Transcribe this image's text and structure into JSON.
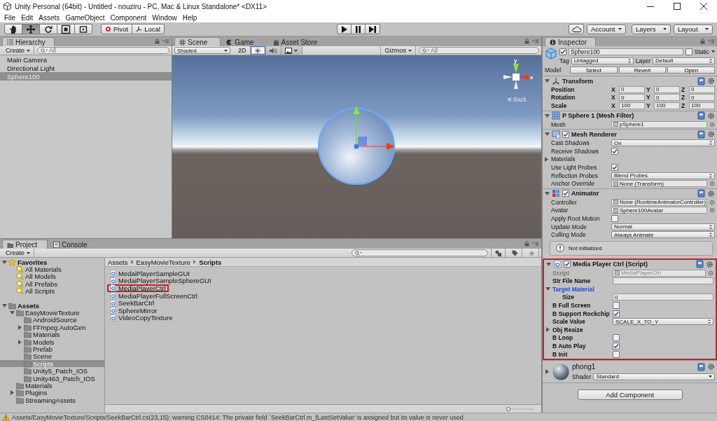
{
  "window": {
    "title": "Unity Personal (64bit) - Untitled - nouziru - PC, Mac & Linux Standalone* <DX11>"
  },
  "menu": [
    "File",
    "Edit",
    "Assets",
    "GameObject",
    "Component",
    "Window",
    "Help"
  ],
  "toolbar": {
    "tools": [
      {
        "kind": "hand",
        "selected": false
      },
      {
        "kind": "move",
        "selected": true
      },
      {
        "kind": "rotate",
        "selected": false
      },
      {
        "kind": "scale",
        "selected": false
      },
      {
        "kind": "rect",
        "selected": false
      }
    ],
    "pivot": "Pivot",
    "space": "Local",
    "account": "Account",
    "layers": "Layers",
    "layout": "Layout"
  },
  "hierarchy": {
    "tab": "Hierarchy",
    "create": "Create",
    "search_placeholder": "All",
    "items": [
      {
        "label": "Main Camera",
        "selected": false
      },
      {
        "label": "Directional Light",
        "selected": false
      },
      {
        "label": "Sphere100",
        "selected": true
      }
    ]
  },
  "scene": {
    "tabs": [
      {
        "label": "Scene",
        "selected": true
      },
      {
        "label": "Game",
        "selected": false
      },
      {
        "label": "Asset Store",
        "selected": false
      }
    ],
    "shading": "Shaded",
    "mode_2d": "2D",
    "toggles": [
      {
        "kind": "lighting",
        "on": true
      },
      {
        "kind": "audio",
        "on": false
      },
      {
        "kind": "effects"
      }
    ],
    "gizmos": "Gizmos",
    "search_placeholder": "All",
    "axis_labels": [
      "y",
      "x"
    ],
    "view_label": "Back"
  },
  "inspector": {
    "tab": "Inspector",
    "object": {
      "active": true,
      "name": "Sphere100",
      "static": false,
      "static_label": "Static",
      "tag_label": "Tag",
      "tag": "Untagged",
      "layer_label": "Layer",
      "layer": "Default",
      "model_label": "Model",
      "model_buttons": [
        "Select",
        "Revert",
        "Open"
      ]
    },
    "components": [
      {
        "kind": "transform",
        "title": "Transform",
        "expanded": true,
        "highlighted": false,
        "rows": [
          {
            "kind": "vector3",
            "label": "Position",
            "values": [
              {
                "axis": "X",
                "value": "0"
              },
              {
                "axis": "Y",
                "value": "0"
              },
              {
                "axis": "Z",
                "value": "0"
              }
            ]
          },
          {
            "kind": "vector3",
            "label": "Rotation",
            "values": [
              {
                "axis": "X",
                "value": "0"
              },
              {
                "axis": "Y",
                "value": "0"
              },
              {
                "axis": "Z",
                "value": "0"
              }
            ]
          },
          {
            "kind": "vector3",
            "label": "Scale",
            "values": [
              {
                "axis": "X",
                "value": "100"
              },
              {
                "axis": "Y",
                "value": "100"
              },
              {
                "axis": "Z",
                "value": "100"
              }
            ]
          }
        ]
      },
      {
        "kind": "mesh_filter",
        "title": "P Sphere 1 (Mesh Filter)",
        "expanded": true,
        "highlighted": false,
        "rows": [
          {
            "kind": "object",
            "label": "Mesh",
            "value": "pSphere1",
            "disabled": false
          }
        ]
      },
      {
        "kind": "mesh_renderer",
        "title": "Mesh Renderer",
        "enabled": true,
        "expanded": true,
        "highlighted": false,
        "rows": [
          {
            "kind": "dropdown",
            "label": "Cast Shadows",
            "value": "On"
          },
          {
            "kind": "checkbox",
            "label": "Receive Shadows",
            "checked": true
          },
          {
            "kind": "foldout",
            "label": "Materials",
            "expanded": false,
            "focused": false
          },
          {
            "kind": "checkbox",
            "label": "Use Light Probes",
            "checked": true
          },
          {
            "kind": "dropdown",
            "label": "Reflection Probes",
            "value": "Blend Probes"
          },
          {
            "kind": "object",
            "label": "Anchor Override",
            "value": "None (Transform)",
            "disabled": false
          }
        ]
      },
      {
        "kind": "animator",
        "title": "Animator",
        "enabled": true,
        "expanded": true,
        "highlighted": false,
        "rows": [
          {
            "kind": "object",
            "label": "Controller",
            "value": "None (RuntimeAnimatorController)",
            "disabled": false
          },
          {
            "kind": "object",
            "label": "Avatar",
            "value": "Sphere100Avatar",
            "disabled": false
          },
          {
            "kind": "checkbox",
            "label": "Apply Root Motion",
            "checked": false
          },
          {
            "kind": "dropdown",
            "label": "Update Mode",
            "value": "Normal"
          },
          {
            "kind": "dropdown",
            "label": "Culling Mode",
            "value": "Always Animate"
          },
          {
            "kind": "info",
            "text": "Not initialized"
          }
        ]
      },
      {
        "kind": "script",
        "title": "Media Player Ctrl (Script)",
        "enabled": true,
        "expanded": true,
        "highlighted": true,
        "rows": [
          {
            "kind": "object",
            "label": "Script",
            "value": "MediaPlayerCtrl",
            "disabled": true
          },
          {
            "kind": "text",
            "label": "Str File Name"
          },
          {
            "kind": "foldout",
            "label": "Target Material",
            "expanded": true,
            "focused": true,
            "children": [
              {
                "kind": "text",
                "label": "Size",
                "value": "0"
              }
            ]
          },
          {
            "kind": "checkbox",
            "label": "B Full Screen",
            "checked": false
          },
          {
            "kind": "checkbox",
            "label": "B Support Rockchip",
            "checked": true
          },
          {
            "kind": "dropdown",
            "label": "Scale Value",
            "value": "SCALE_X_TO_Y"
          },
          {
            "kind": "foldout",
            "label": "Obj Resize",
            "expanded": false,
            "focused": false
          },
          {
            "kind": "checkbox",
            "label": "B Loop",
            "checked": false
          },
          {
            "kind": "checkbox",
            "label": "B Auto Play",
            "checked": true
          },
          {
            "kind": "checkbox",
            "label": "B Init",
            "checked": false
          }
        ]
      }
    ],
    "material": {
      "name": "phong1",
      "expanded": false,
      "shader_label": "Shader",
      "shader": "Standard"
    },
    "add_component": "Add Component"
  },
  "project": {
    "tabs": [
      {
        "label": "Project",
        "selected": true
      },
      {
        "label": "Console",
        "selected": false
      }
    ],
    "create": "Create",
    "tree": [
      {
        "label": "Favorites",
        "kind": "favorites",
        "expanded": true,
        "selected": false,
        "children": [
          {
            "label": "All Materials",
            "kind": "search",
            "selected": false
          },
          {
            "label": "All Models",
            "kind": "search",
            "selected": false
          },
          {
            "label": "All Prefabs",
            "kind": "search",
            "selected": false
          },
          {
            "label": "All Scripts",
            "kind": "search",
            "selected": false
          }
        ]
      },
      {
        "label": "Assets",
        "kind": "folder",
        "expanded": true,
        "selected": false,
        "children": [
          {
            "label": "EasyMovieTexture",
            "kind": "folder",
            "expanded": true,
            "selected": false,
            "children": [
              {
                "label": "AndroidSource",
                "kind": "folder",
                "selected": false
              },
              {
                "label": "FFmpeg.AutoGen",
                "kind": "folder",
                "expanded": false,
                "selected": false
              },
              {
                "label": "Materials",
                "kind": "folder",
                "selected": false
              },
              {
                "label": "Models",
                "kind": "folder",
                "expanded": false,
                "selected": false
              },
              {
                "label": "Prefab",
                "kind": "folder",
                "selected": false
              },
              {
                "label": "Scene",
                "kind": "folder",
                "selected": false
              },
              {
                "label": "Scripts",
                "kind": "folder",
                "selected": true
              },
              {
                "label": "Unity5_Patch_IOS",
                "kind": "folder",
                "selected": false
              },
              {
                "label": "Unity463_Patch_IOS",
                "kind": "folder",
                "selected": false
              }
            ]
          },
          {
            "label": "Materials",
            "kind": "folder",
            "selected": false
          },
          {
            "label": "Plugins",
            "kind": "folder",
            "expanded": false,
            "selected": false
          },
          {
            "label": "StreamingAssets",
            "kind": "folder",
            "selected": false
          }
        ]
      }
    ],
    "breadcrumb": [
      "Assets",
      "EasyMovieTexture",
      "Scripts"
    ],
    "files": [
      {
        "name": "MedaiPlayerSampleGUI",
        "highlighted": false
      },
      {
        "name": "MedaiPlayerSampleSphereGUI",
        "highlighted": false
      },
      {
        "name": "MediaPlayerCtrl",
        "highlighted": true
      },
      {
        "name": "MediaPlayerFullScreenCtrl",
        "highlighted": false
      },
      {
        "name": "SeekBarCtrl",
        "highlighted": false
      },
      {
        "name": "SphereMirror",
        "highlighted": false
      },
      {
        "name": "VideoCopyTexture",
        "highlighted": false
      }
    ],
    "icon_size": {
      "level": 0
    }
  },
  "status_bar": {
    "message": "Assets/EasyMovieTexture/Scripts/SeekBarCtrl.cs(23,15): warning CS0414: The private field `SeekBarCtrl.m_fLastSetValue' is assigned but its value is never used"
  }
}
